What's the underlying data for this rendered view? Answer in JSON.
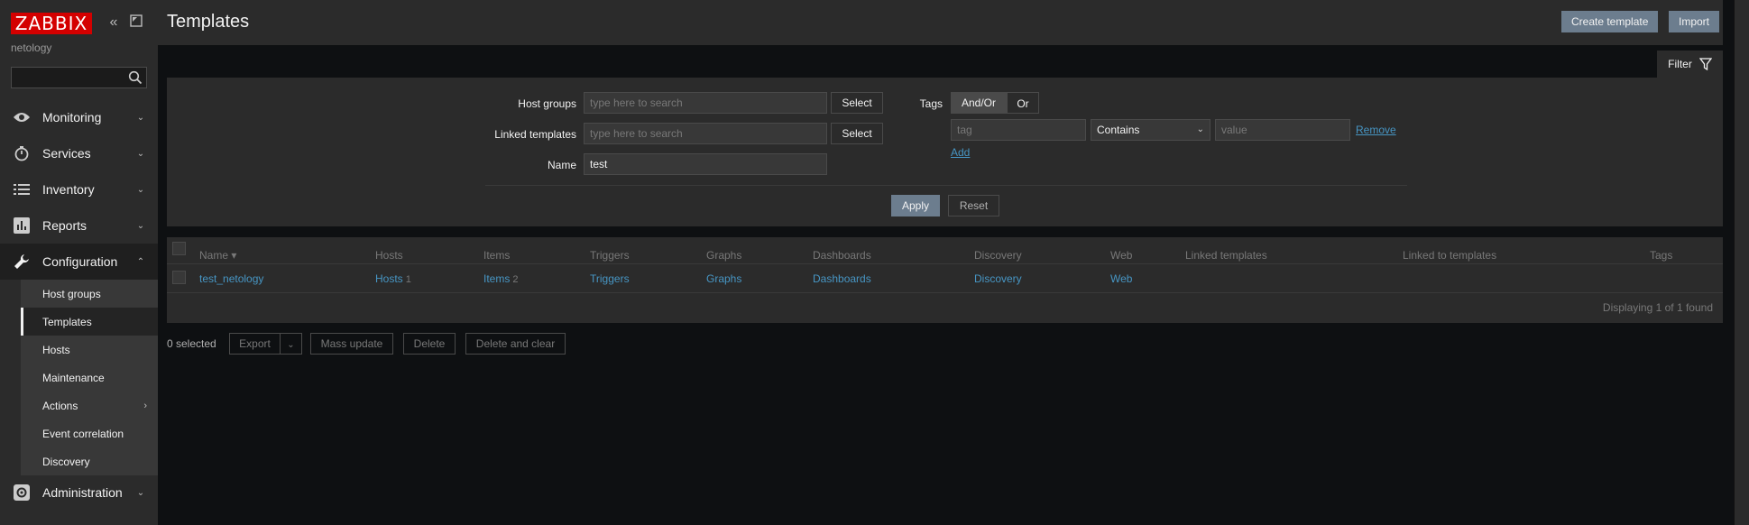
{
  "app": {
    "logo": "ZABBIX",
    "server_name": "netology"
  },
  "sidebar": {
    "collapse_icon": "double-chevron-left-icon",
    "kiosk_icon": "kiosk-mode-icon",
    "search_value": "",
    "menu": [
      {
        "label": "Monitoring",
        "icon": "eye-icon"
      },
      {
        "label": "Services",
        "icon": "stopwatch-icon"
      },
      {
        "label": "Inventory",
        "icon": "list-icon"
      },
      {
        "label": "Reports",
        "icon": "bar-chart-icon"
      },
      {
        "label": "Configuration",
        "icon": "wrench-icon"
      },
      {
        "label": "Administration",
        "icon": "gear-icon"
      }
    ],
    "submenu": [
      "Host groups",
      "Templates",
      "Hosts",
      "Maintenance",
      "Actions",
      "Event correlation",
      "Discovery"
    ],
    "active_submenu": "Templates"
  },
  "header": {
    "title": "Templates",
    "create_label": "Create template",
    "import_label": "Import"
  },
  "filter": {
    "tab_label": "Filter",
    "host_groups_label": "Host groups",
    "host_groups_placeholder": "type here to search",
    "linked_label": "Linked templates",
    "linked_placeholder": "type here to search",
    "select_label": "Select",
    "name_label": "Name",
    "name_value": "test",
    "tags_label": "Tags",
    "andor_label": "And/Or",
    "or_label": "Or",
    "tag_placeholder": "tag",
    "operator_value": "Contains",
    "value_placeholder": "value",
    "remove_label": "Remove",
    "add_label": "Add",
    "apply_label": "Apply",
    "reset_label": "Reset"
  },
  "table": {
    "columns": [
      "Name ▾",
      "Hosts",
      "Items",
      "Triggers",
      "Graphs",
      "Dashboards",
      "Discovery",
      "Web",
      "Linked templates",
      "Linked to templates",
      "Tags"
    ],
    "rows": [
      {
        "name": "test_netology",
        "hosts": "Hosts",
        "hosts_count": "1",
        "items": "Items",
        "items_count": "2",
        "triggers": "Triggers",
        "graphs": "Graphs",
        "dashboards": "Dashboards",
        "discovery": "Discovery",
        "web": "Web"
      }
    ],
    "footer": "Displaying 1 of 1 found"
  },
  "actions": {
    "selected": "0 selected",
    "export": "Export",
    "mass_update": "Mass update",
    "delete": "Delete",
    "delete_clear": "Delete and clear"
  },
  "colors": {
    "accent": "#d40000",
    "link": "#4796c4",
    "primary_button": "#6c7d8e"
  }
}
